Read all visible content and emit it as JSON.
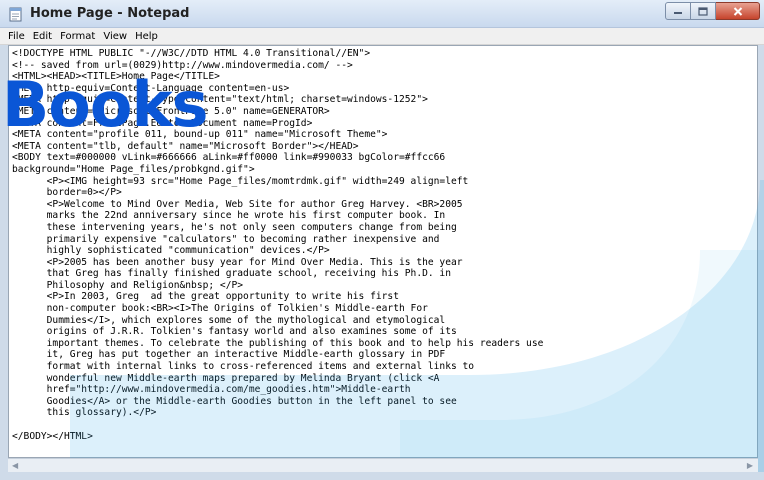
{
  "window": {
    "title": "Home Page - Notepad"
  },
  "menu": {
    "items": [
      "File",
      "Edit",
      "Format",
      "View",
      "Help"
    ]
  },
  "editor": {
    "content": "<!DOCTYPE HTML PUBLIC \"-//W3C//DTD HTML 4.0 Transitional//EN\">\n<!-- saved from url=(0029)http://www.mindovermedia.com/ -->\n<HTML><HEAD><TITLE>Home Page</TITLE>\n<META http-equiv=Content-Language content=en-us>\n<META http-equiv=Content-Type content=\"text/html; charset=windows-1252\">\n<META content=\"Microsoft FrontPage 5.0\" name=GENERATOR>\n<META content=FrontPage.Editor.Document name=ProgId>\n<META content=\"profile 011, bound-up 011\" name=\"Microsoft Theme\">\n<META content=\"tlb, default\" name=\"Microsoft Border\"></HEAD>\n<BODY text=#000000 vLink=#666666 aLink=#ff0000 link=#990033 bgColor=#ffcc66\nbackground=\"Home Page_files/probkgnd.gif\">\n      <P><IMG height=93 src=\"Home Page_files/momtrdmk.gif\" width=249 align=left\n      border=0></P>\n      <P>Welcome to Mind Over Media, Web Site for author Greg Harvey. <BR>2005\n      marks the 22nd anniversary since he wrote his first computer book. In\n      these intervening years, he's not only seen computers change from being\n      primarily expensive \"calculators\" to becoming rather inexpensive and\n      highly sophisticated \"communication\" devices.</P>\n      <P>2005 has been another busy year for Mind Over Media. This is the year\n      that Greg has finally finished graduate school, receiving his Ph.D. in\n      Philosophy and Religion&nbsp; </P>\n      <P>In 2003, Greg  ad the great opportunity to write his first\n      non-computer book:<BR><I>The Origins of Tolkien's Middle-earth For\n      Dummies</I>, which explores some of the mythological and etymological\n      origins of J.R.R. Tolkien's fantasy world and also examines some of its\n      important themes. To celebrate the publishing of this book and to help his readers use\n      it, Greg has put together an interactive Middle-earth glossary in PDF\n      format with internal links to cross-referenced items and external links to\n      wonderful new Middle-earth maps prepared by Melinda Bryant (click <A\n      href=\"http://www.mindovermedia.com/me_goodies.htm\">Middle-earth\n      Goodies</A> or the Middle-earth Goodies button in the left panel to see\n      this glossary).</P>\n\n</BODY></HTML>"
  },
  "watermark": {
    "text": "Books",
    "color": "#0a56d6",
    "shape_color": "#2fa8e6"
  }
}
